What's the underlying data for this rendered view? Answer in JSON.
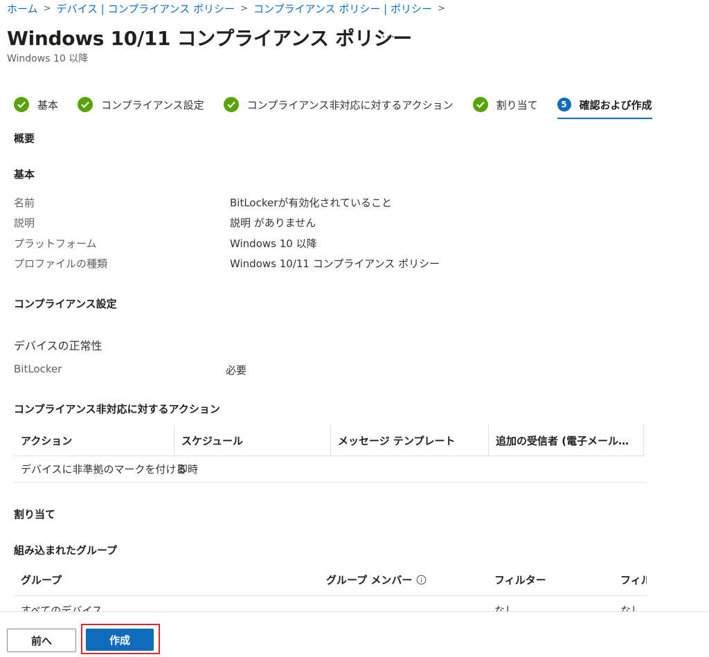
{
  "breadcrumb": {
    "items": [
      "ホーム",
      "デバイス | コンプライアンス ポリシー",
      "コンプライアンス ポリシー | ポリシー"
    ]
  },
  "page": {
    "title": "Windows 10/11 コンプライアンス ポリシー",
    "more": "...",
    "subtitle": "Windows 10 以降"
  },
  "steps": [
    {
      "label": "基本",
      "state": "done"
    },
    {
      "label": "コンプライアンス設定",
      "state": "done"
    },
    {
      "label": "コンプライアンス非対応に対するアクション",
      "state": "done"
    },
    {
      "label": "割り当て",
      "state": "done"
    },
    {
      "label": "確認および作成",
      "state": "active",
      "number": "5"
    }
  ],
  "summary": {
    "heading": "概要",
    "basics": {
      "heading": "基本",
      "rows": [
        {
          "label": "名前",
          "value": "BitLockerが有効化されていること"
        },
        {
          "label": "説明",
          "value": "説明 がありません"
        },
        {
          "label": "プラットフォーム",
          "value": "Windows 10 以降"
        },
        {
          "label": "プロファイルの種類",
          "value": "Windows 10/11 コンプライアンス ポリシー"
        }
      ]
    },
    "compliance": {
      "heading": "コンプライアンス設定",
      "subheading": "デバイスの正常性",
      "setting_label": "BitLocker",
      "setting_value": "必要"
    },
    "actions": {
      "heading": "コンプライアンス非対応に対するアクション",
      "columns": [
        "アクション",
        "スケジュール",
        "メッセージ テンプレート",
        "追加の受信者 (電子メール…"
      ],
      "rows": [
        [
          "デバイスに非準拠のマークを付ける",
          "即時",
          "",
          ""
        ]
      ]
    },
    "assignments": {
      "heading": "割り当て",
      "included_heading": "組み込まれたグループ",
      "columns": [
        "グループ",
        "グループ メンバー",
        "フィルター",
        "フィル"
      ],
      "rows": [
        [
          "すべてのデバイス",
          "",
          "なし",
          "なし"
        ]
      ]
    }
  },
  "footer": {
    "prev_label": "前へ",
    "create_label": "作成"
  },
  "colors": {
    "accent": "#0f6cbd",
    "success": "#57a300",
    "highlight": "#d9232f"
  }
}
